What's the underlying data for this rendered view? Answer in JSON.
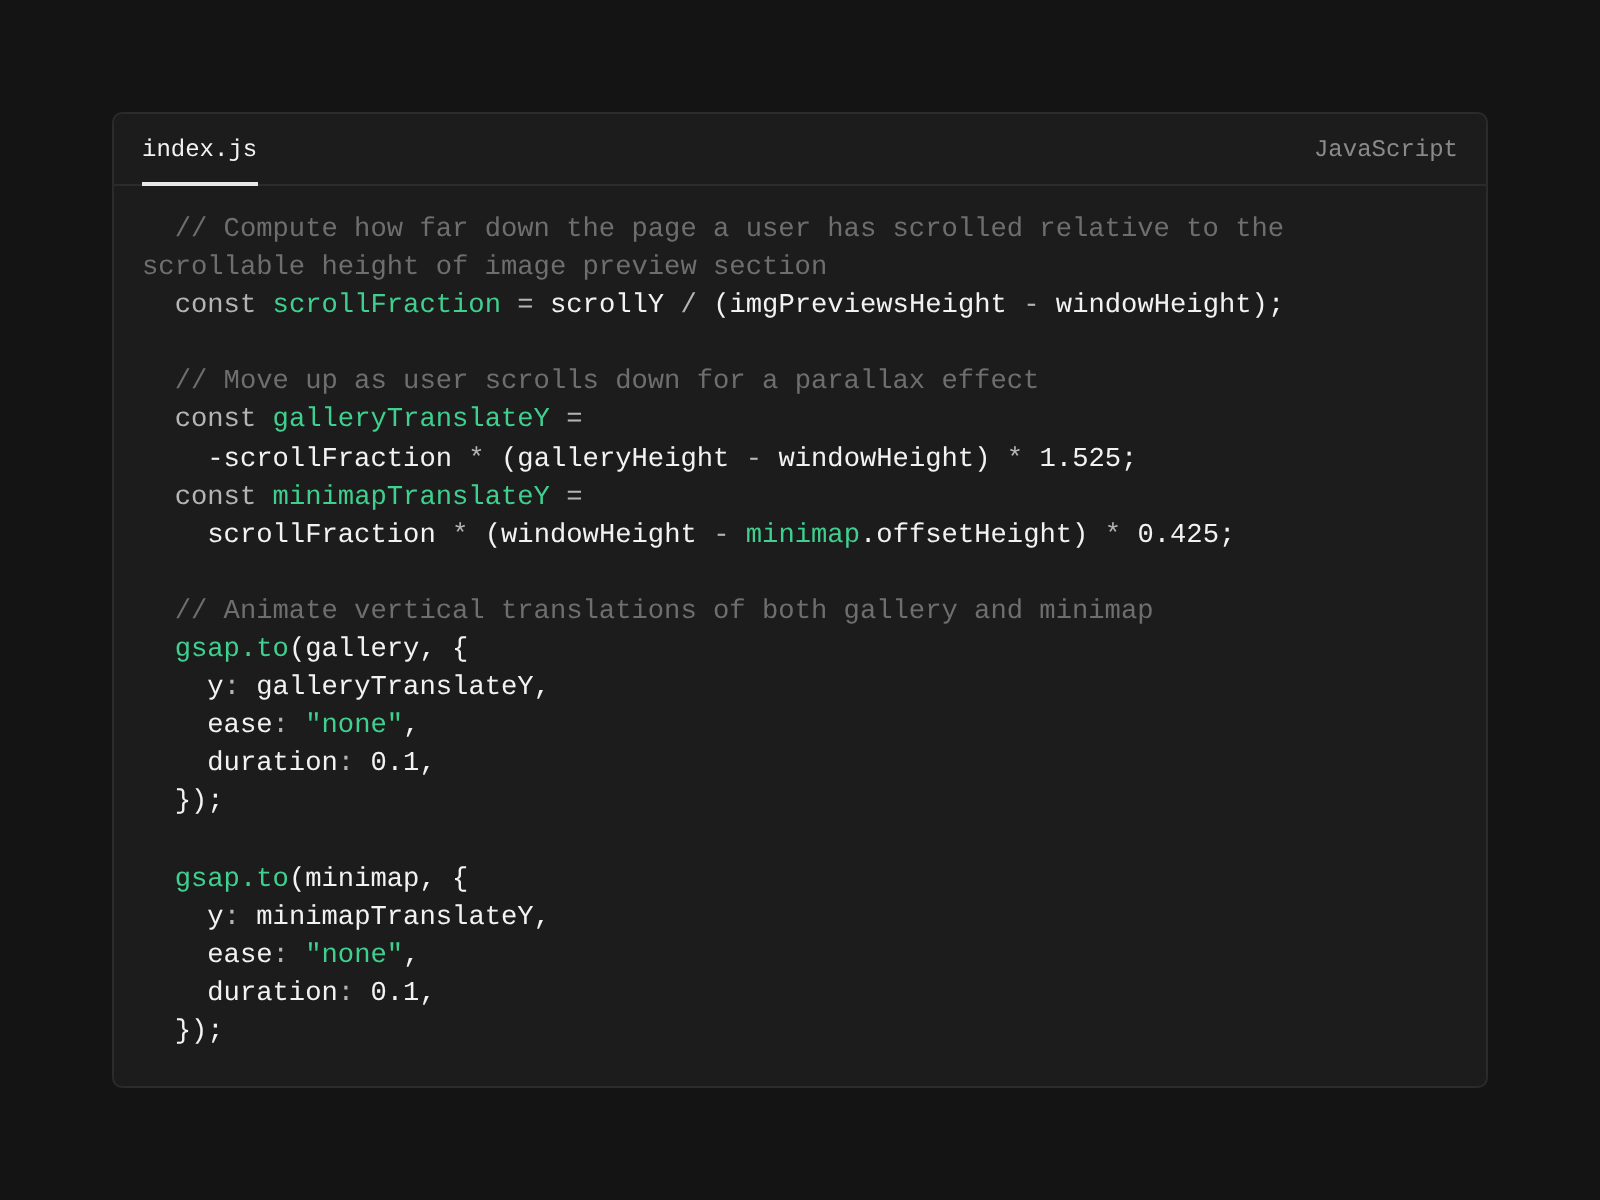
{
  "header": {
    "tabs": [
      {
        "label": "index.js",
        "selected": true
      }
    ],
    "language": "JavaScript"
  },
  "code": [
    {
      "kind": "code",
      "tokens": [
        {
          "text": "  // Compute how far down the page a user has scrolled relative to the scrollable height of image preview section",
          "kind": "comment"
        }
      ]
    },
    {
      "kind": "code",
      "tokens": [
        {
          "text": "  const ",
          "kind": "muted"
        },
        {
          "text": "scrollFraction",
          "kind": "accent"
        },
        {
          "text": " = ",
          "kind": "muted"
        },
        {
          "text": "scrollY",
          "kind": "plain"
        },
        {
          "text": " / ",
          "kind": "muted"
        },
        {
          "text": "(imgPreviewsHeight",
          "kind": "plain"
        },
        {
          "text": " - ",
          "kind": "muted"
        },
        {
          "text": "windowHeight);",
          "kind": "plain"
        }
      ]
    },
    {
      "kind": "blank"
    },
    {
      "kind": "code",
      "tokens": [
        {
          "text": "  // Move up as user scrolls down for a parallax effect",
          "kind": "comment"
        }
      ]
    },
    {
      "kind": "code",
      "tokens": [
        {
          "text": "  const ",
          "kind": "muted"
        },
        {
          "text": "galleryTranslateY",
          "kind": "accent"
        },
        {
          "text": " =",
          "kind": "muted"
        }
      ]
    },
    {
      "kind": "code",
      "tokens": [
        {
          "text": "    -scrollFraction",
          "kind": "plain"
        },
        {
          "text": " * ",
          "kind": "muted"
        },
        {
          "text": "(galleryHeight",
          "kind": "plain"
        },
        {
          "text": " - ",
          "kind": "muted"
        },
        {
          "text": "windowHeight)",
          "kind": "plain"
        },
        {
          "text": " * ",
          "kind": "muted"
        },
        {
          "text": "1.525;",
          "kind": "plain"
        }
      ]
    },
    {
      "kind": "code",
      "tokens": [
        {
          "text": "  const ",
          "kind": "muted"
        },
        {
          "text": "minimapTranslateY",
          "kind": "accent"
        },
        {
          "text": " =",
          "kind": "muted"
        }
      ]
    },
    {
      "kind": "code",
      "tokens": [
        {
          "text": "    scrollFraction",
          "kind": "plain"
        },
        {
          "text": " * ",
          "kind": "muted"
        },
        {
          "text": "(windowHeight",
          "kind": "plain"
        },
        {
          "text": " - ",
          "kind": "muted"
        },
        {
          "text": "minimap",
          "kind": "accent"
        },
        {
          "text": ".offsetHeight)",
          "kind": "plain"
        },
        {
          "text": " * ",
          "kind": "muted"
        },
        {
          "text": "0.425;",
          "kind": "plain"
        }
      ]
    },
    {
      "kind": "blank"
    },
    {
      "kind": "code",
      "tokens": [
        {
          "text": "  // Animate vertical translations of both gallery and minimap",
          "kind": "comment"
        }
      ]
    },
    {
      "kind": "code",
      "tokens": [
        {
          "text": "  gsap.to",
          "kind": "accent"
        },
        {
          "text": "(gallery, {",
          "kind": "plain"
        }
      ]
    },
    {
      "kind": "code",
      "tokens": [
        {
          "text": "    y",
          "kind": "plain"
        },
        {
          "text": ": ",
          "kind": "muted"
        },
        {
          "text": "galleryTranslateY,",
          "kind": "plain"
        }
      ]
    },
    {
      "kind": "code",
      "tokens": [
        {
          "text": "    ease",
          "kind": "plain"
        },
        {
          "text": ": ",
          "kind": "muted"
        },
        {
          "text": "\"none\"",
          "kind": "accent"
        },
        {
          "text": ",",
          "kind": "plain"
        }
      ]
    },
    {
      "kind": "code",
      "tokens": [
        {
          "text": "    duration",
          "kind": "plain"
        },
        {
          "text": ": ",
          "kind": "muted"
        },
        {
          "text": "0.1,",
          "kind": "plain"
        }
      ]
    },
    {
      "kind": "code",
      "tokens": [
        {
          "text": "  });",
          "kind": "plain"
        }
      ]
    },
    {
      "kind": "blank"
    },
    {
      "kind": "code",
      "tokens": [
        {
          "text": "  gsap.to",
          "kind": "accent"
        },
        {
          "text": "(minimap, {",
          "kind": "plain"
        }
      ]
    },
    {
      "kind": "code",
      "tokens": [
        {
          "text": "    y",
          "kind": "plain"
        },
        {
          "text": ": ",
          "kind": "muted"
        },
        {
          "text": "minimapTranslateY,",
          "kind": "plain"
        }
      ]
    },
    {
      "kind": "code",
      "tokens": [
        {
          "text": "    ease",
          "kind": "plain"
        },
        {
          "text": ": ",
          "kind": "muted"
        },
        {
          "text": "\"none\"",
          "kind": "accent"
        },
        {
          "text": ",",
          "kind": "plain"
        }
      ]
    },
    {
      "kind": "code",
      "tokens": [
        {
          "text": "    duration",
          "kind": "plain"
        },
        {
          "text": ": ",
          "kind": "muted"
        },
        {
          "text": "0.1,",
          "kind": "plain"
        }
      ]
    },
    {
      "kind": "code",
      "tokens": [
        {
          "text": "  });",
          "kind": "plain"
        }
      ]
    }
  ]
}
